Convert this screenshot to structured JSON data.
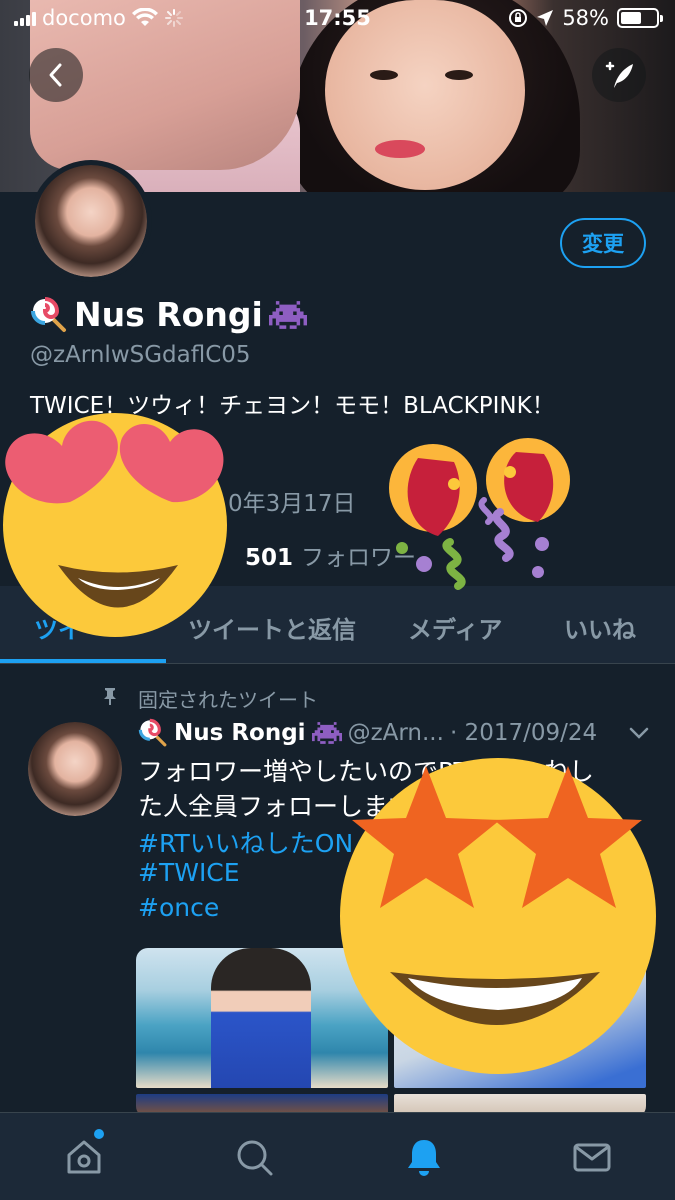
{
  "status_bar": {
    "carrier": "docomo",
    "time": "17:55",
    "battery_percent": "58%",
    "battery_level": 0.58
  },
  "header": {
    "back_icon": "chevron-left-icon",
    "compose_icon": "compose-feather-icon"
  },
  "profile": {
    "edit_button_label": "変更",
    "display_name": "Nus Rongi",
    "name_prefix_emoji": "🍭",
    "name_suffix_emoji": "👾",
    "handle": "@zArnlwSGdaflC05",
    "bio": "TWICE！ツウィ！チェヨン！モモ！BLACKPINK！",
    "joined_partial": "0年3月17日",
    "followers_count": "501",
    "followers_label": "フォロワー"
  },
  "tabs": [
    {
      "label": "ツイ",
      "active": true
    },
    {
      "label": "ツイートと返信",
      "active": false
    },
    {
      "label": "メディア",
      "active": false
    },
    {
      "label": "いいね",
      "active": false
    }
  ],
  "pinned_tweet": {
    "pinned_label": "固定されたツイート",
    "name": "Nus Rongi",
    "handle_truncated": "@zArn...",
    "date": "· 2017/09/24",
    "text_line1": "フォロワー増やしたいのでRTといいねし",
    "text_line2": "た人全員フォローします",
    "hashtags": [
      "#RTいいねしたON",
      "#TWICE",
      "#once"
    ]
  },
  "stickers": [
    "heart-eyes-emoji",
    "party-popper-emoji",
    "star-struck-emoji"
  ],
  "bottom_nav": [
    {
      "name": "home",
      "icon": "home-icon",
      "has_badge": true
    },
    {
      "name": "search",
      "icon": "search-icon",
      "has_badge": false
    },
    {
      "name": "notifications",
      "icon": "bell-icon",
      "active": true
    },
    {
      "name": "messages",
      "icon": "mail-icon",
      "has_badge": false
    }
  ],
  "colors": {
    "background": "#15202b",
    "accent": "#1da1f2",
    "secondary_text": "#8899a6",
    "bar_background": "#1c2938"
  }
}
